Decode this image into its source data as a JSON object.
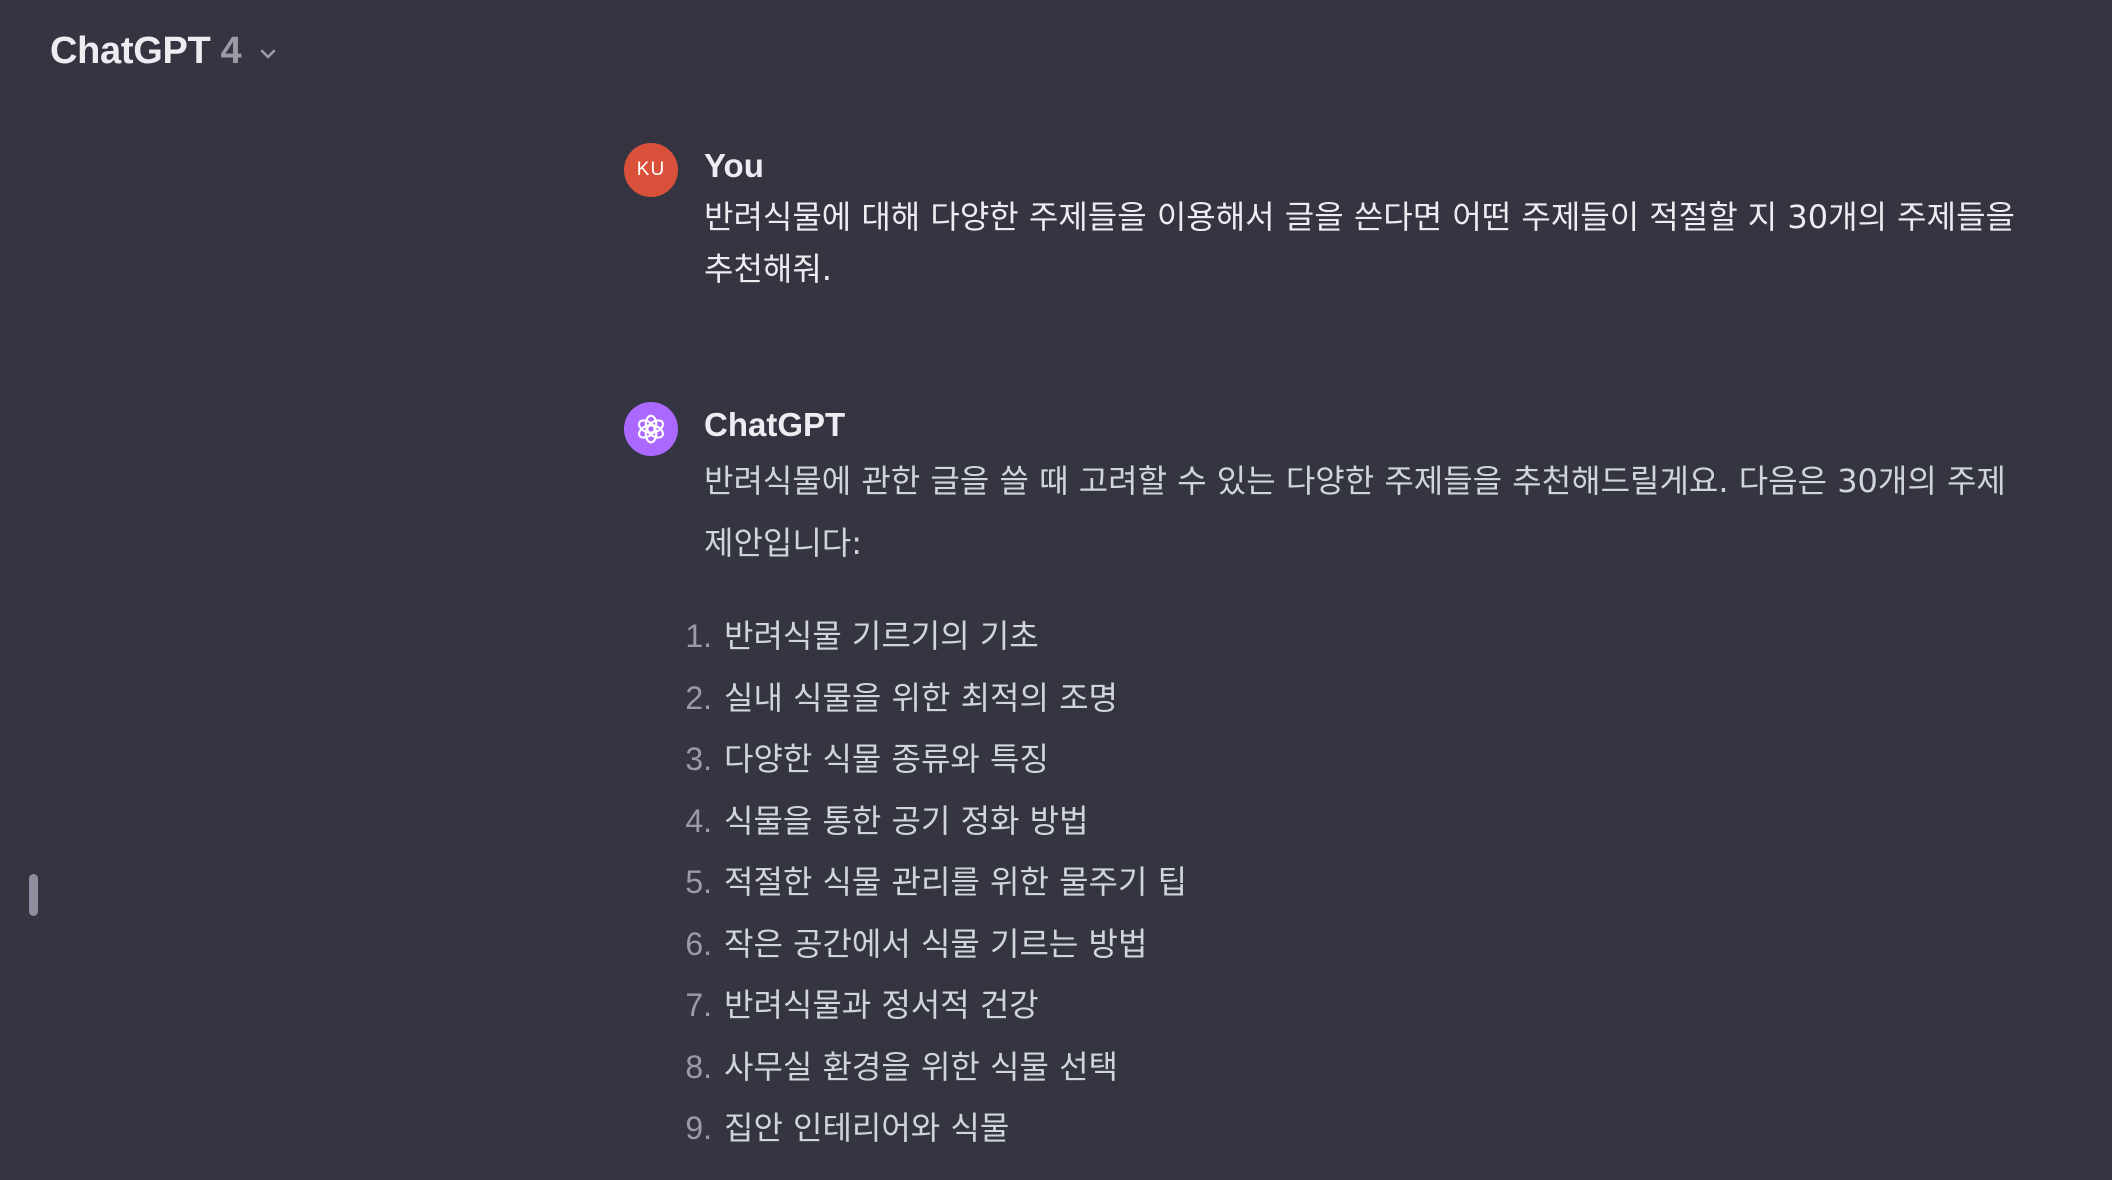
{
  "header": {
    "model_name": "ChatGPT",
    "model_version": "4",
    "dropdown_icon": "chevron-down-icon"
  },
  "colors": {
    "background": "#343541",
    "user_avatar": "#d9503b",
    "assistant_avatar": "#ab68ff",
    "text_primary": "#ececf1",
    "text_secondary": "#d1d5db"
  },
  "user_message": {
    "avatar_initials": "KU",
    "author": "You",
    "text": "반려식물에 대해 다양한 주제들을 이용해서 글을 쓴다면 어떤 주제들이 적절할 지 30개의 주제들을 추천해줘."
  },
  "assistant_message": {
    "avatar_icon": "openai-logo-icon",
    "author": "ChatGPT",
    "intro": "반려식물에 관한 글을 쓸 때 고려할 수 있는 다양한 주제들을 추천해드릴게요. 다음은 30개의 주제 제안입니다:",
    "topics": [
      {
        "num": "1.",
        "text": "반려식물 기르기의 기초"
      },
      {
        "num": "2.",
        "text": "실내 식물을 위한 최적의 조명"
      },
      {
        "num": "3.",
        "text": "다양한 식물 종류와 특징"
      },
      {
        "num": "4.",
        "text": "식물을 통한 공기 정화 방법"
      },
      {
        "num": "5.",
        "text": "적절한 식물 관리를 위한 물주기 팁"
      },
      {
        "num": "6.",
        "text": "작은 공간에서 식물 기르는 방법"
      },
      {
        "num": "7.",
        "text": "반려식물과 정서적 건강"
      },
      {
        "num": "8.",
        "text": "사무실 환경을 위한 식물 선택"
      },
      {
        "num": "9.",
        "text": "집안 인테리어와 식물"
      }
    ]
  }
}
